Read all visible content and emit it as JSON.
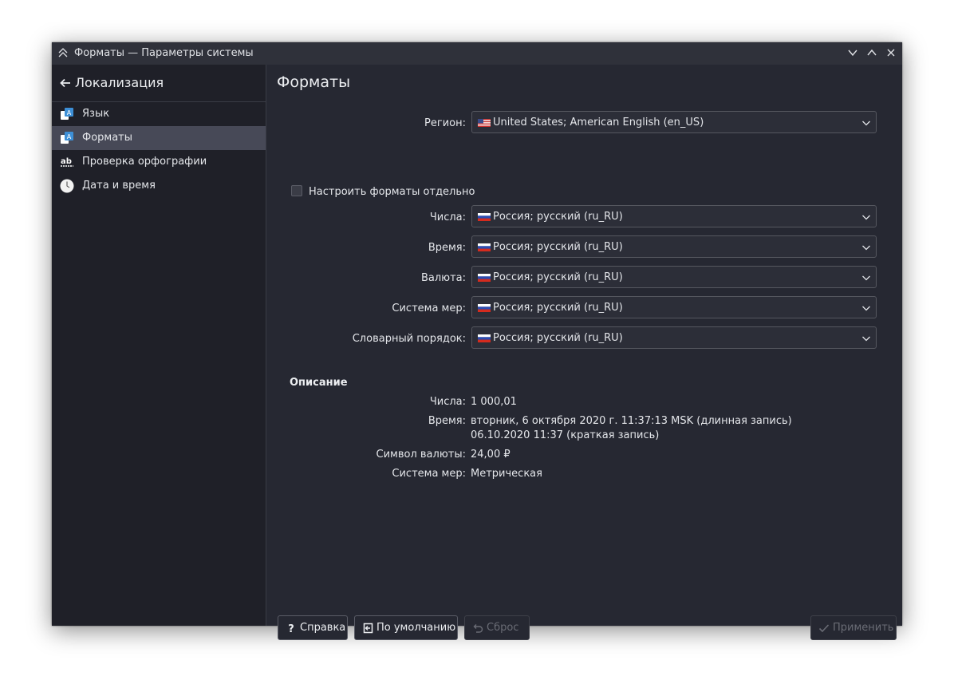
{
  "window": {
    "title": "Форматы — Параметры системы"
  },
  "sidebar": {
    "header_title": "Локализация",
    "items": [
      {
        "label": "Язык",
        "icon": "language-icon",
        "active": false
      },
      {
        "label": "Форматы",
        "icon": "formats-icon",
        "active": true
      },
      {
        "label": "Проверка орфографии",
        "icon": "spellcheck-icon",
        "active": false
      },
      {
        "label": "Дата и время",
        "icon": "clock-icon",
        "active": false
      }
    ]
  },
  "page": {
    "title": "Форматы",
    "region": {
      "label": "Регион:",
      "value": "United States; American English (en_US)",
      "flag": "us-flag-icon"
    },
    "separate_formats": {
      "label": "Настроить форматы отдельно",
      "checked": false
    },
    "combos": [
      {
        "label": "Числа:",
        "value": "Россия; русский (ru_RU)"
      },
      {
        "label": "Время:",
        "value": "Россия; русский (ru_RU)"
      },
      {
        "label": "Валюта:",
        "value": "Россия; русский (ru_RU)"
      },
      {
        "label": "Система мер:",
        "value": "Россия; русский (ru_RU)"
      },
      {
        "label": "Словарный порядок:",
        "value": "Россия; русский (ru_RU)"
      }
    ],
    "description": {
      "title": "Описание",
      "rows": [
        {
          "label": "Числа:",
          "value": "1 000,01"
        },
        {
          "label": "Время:",
          "value": "вторник, 6 октября 2020 г. 11:37:13 MSK (длинная запись)",
          "value2": "06.10.2020 11:37 (краткая запись)"
        },
        {
          "label": "Символ валюты:",
          "value": "24,00 ₽"
        },
        {
          "label": "Система мер:",
          "value": "Метрическая"
        }
      ]
    }
  },
  "buttons": {
    "help": "Справка",
    "defaults": "По умолчанию",
    "reset": "Сброс",
    "apply": "Применить"
  },
  "colors": {
    "background": "#262832",
    "sidebar": "#1f2028",
    "selected": "#474957",
    "titlebar": "#2f313a"
  }
}
